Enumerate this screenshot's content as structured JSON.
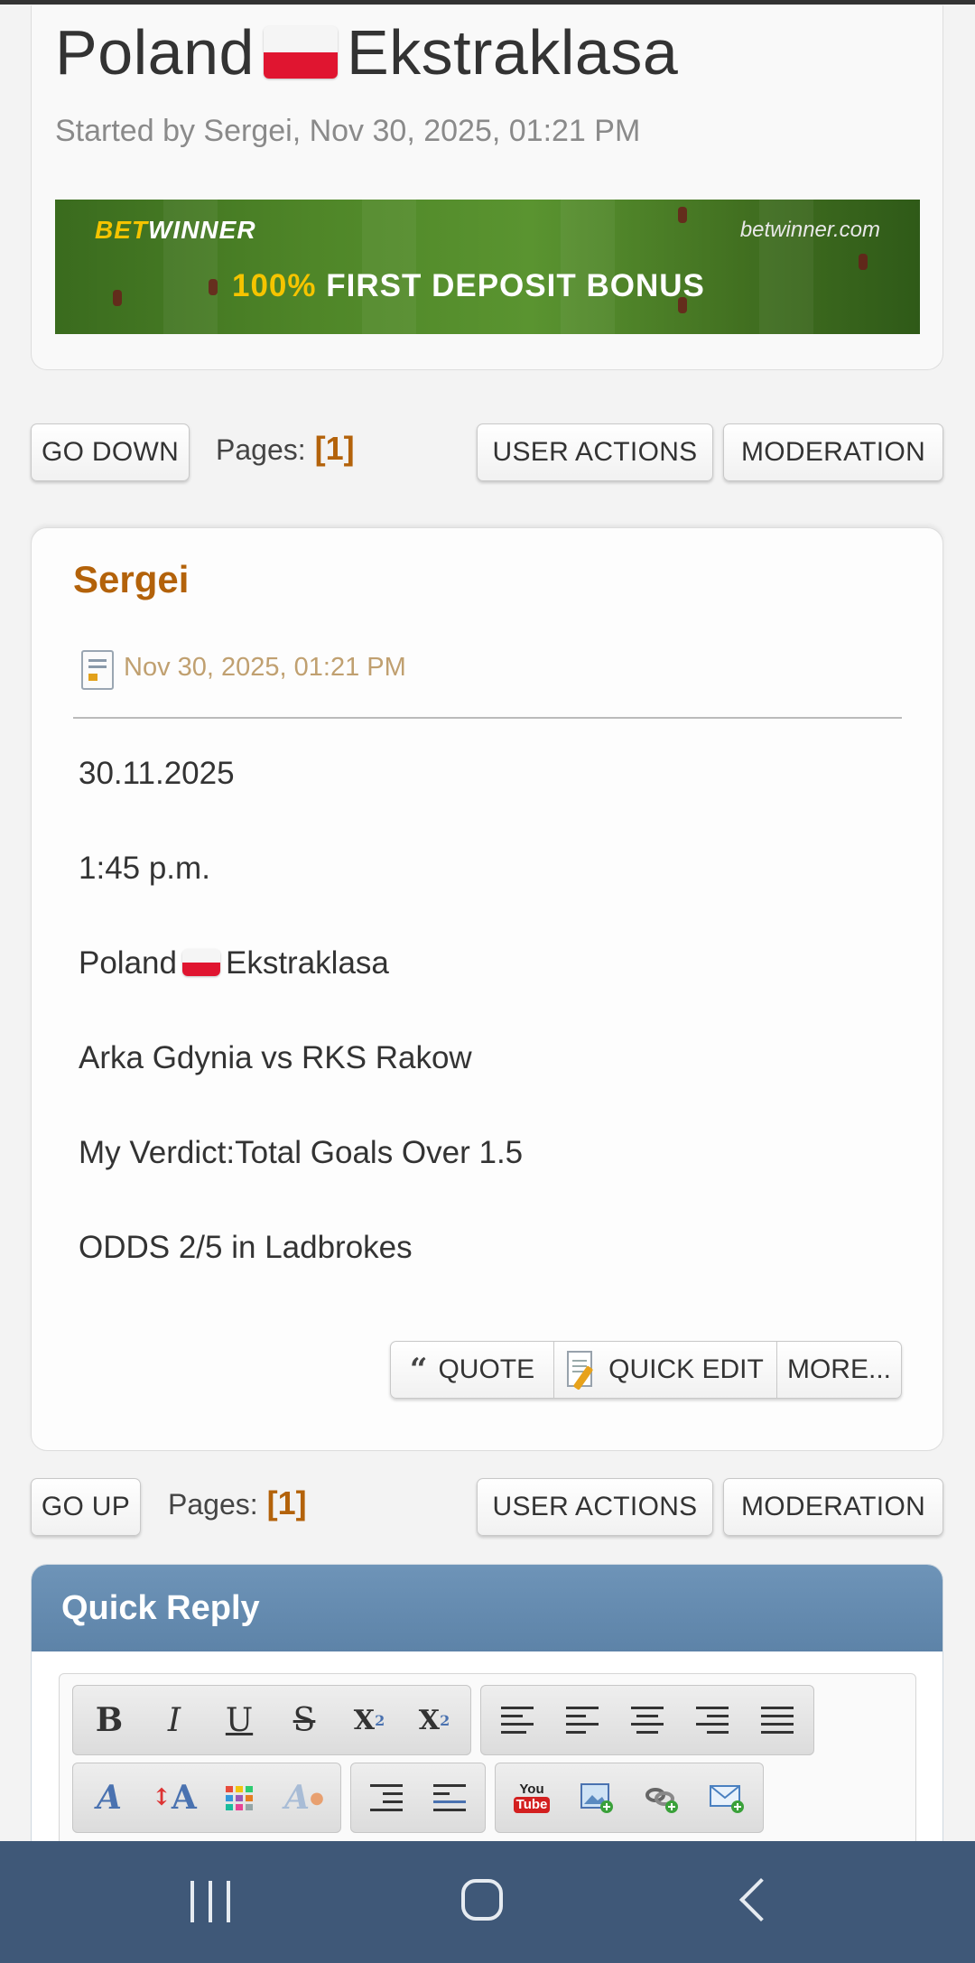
{
  "topic": {
    "title_part1": "Poland",
    "title_part2": "Ekstraklasa",
    "started_by": "Started by Sergei, Nov 30, 2025, 01:21 PM"
  },
  "banner": {
    "brand_part1": "BET",
    "brand_part2": "WINNER",
    "site": "betwinner.com",
    "bonus_part1": "100%",
    "bonus_part2": "FIRST DEPOSIT BONUS"
  },
  "top_nav": {
    "go_label": "GO DOWN",
    "pages_label": "Pages:",
    "current_page": "[1]",
    "user_actions": "USER ACTIONS",
    "moderation": "MODERATION"
  },
  "post": {
    "author": "Sergei",
    "date": "Nov 30, 2025, 01:21 PM",
    "lines": {
      "date": "30.11.2025",
      "time": "1:45 p.m.",
      "league_part1": "Poland",
      "league_part2": "Ekstraklasa",
      "match": "Arka Gdynia vs RKS Rakow",
      "verdict": "My Verdict:Total Goals Over 1.5",
      "odds": "ODDS 2/5 in Ladbrokes"
    },
    "actions": {
      "quote": "QUOTE",
      "quick_edit": "QUICK EDIT",
      "more": "MORE..."
    }
  },
  "bottom_nav": {
    "go_label": "GO UP",
    "pages_label": "Pages:",
    "current_page": "[1]",
    "user_actions": "USER ACTIONS",
    "moderation": "MODERATION"
  },
  "quick_reply": {
    "title": "Quick Reply",
    "toolbar_row1_format": [
      "B",
      "I",
      "U",
      "S",
      "X²",
      "X₂"
    ],
    "toolbar_row1_align": [
      "left",
      "left",
      "center",
      "right",
      "justify"
    ],
    "toolbar_row2_icons": [
      "font-face-icon",
      "font-size-icon",
      "color-icon",
      "remove-format-icon",
      "list-icon",
      "table-icon",
      "youtube-icon",
      "image-icon",
      "link-icon",
      "email-icon"
    ],
    "youtube_label_top": "You",
    "youtube_label_bottom": "Tube"
  },
  "colors": {
    "accent": "#b3620a",
    "quick_reply_header": "#6188ad",
    "navbar": "#3f5878"
  }
}
